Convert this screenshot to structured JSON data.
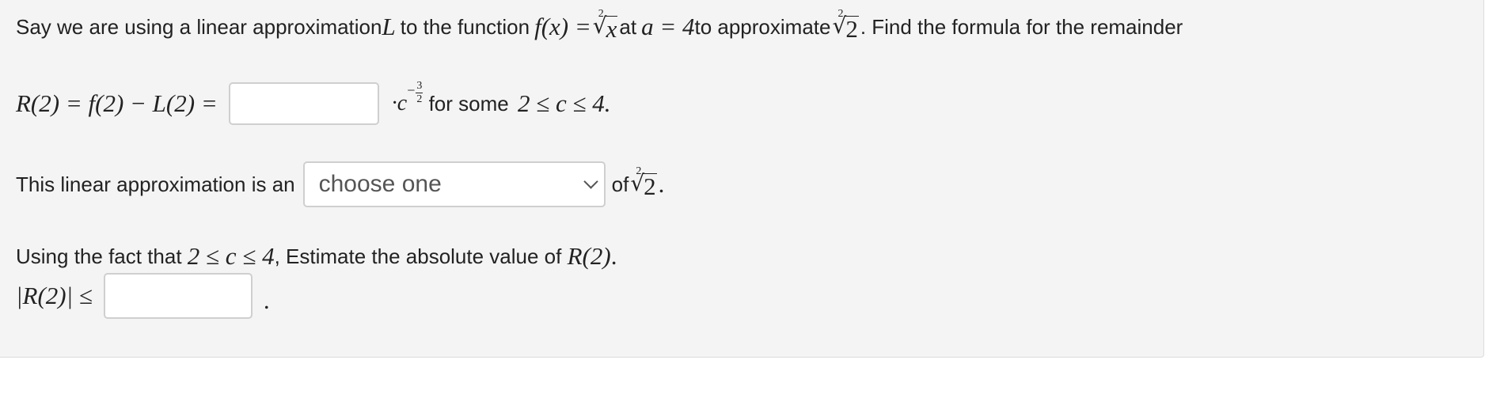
{
  "question": {
    "intro": {
      "t1": "Say we are using a linear approximation ",
      "L": "L",
      "t2": " to the function ",
      "fx": "f(x) = ",
      "rad_index": "2",
      "rad_arg": "x",
      "t3": " at ",
      "a_eq": "a = 4",
      "t4": " to approximate ",
      "rad2_index": "2",
      "rad2_arg": "2",
      "t5": ". Find the formula for the remainder"
    },
    "remainder": {
      "lhs": "R(2) = f(2) − L(2) =",
      "dot_c": "·c",
      "exp_sign": "−",
      "exp_num": "3",
      "exp_den": "2",
      "t1": " for some ",
      "range": "2 ≤ c ≤ 4."
    },
    "approx": {
      "t1": "This linear approximation is an",
      "select_value": "choose one",
      "t2": "of ",
      "rad_index": "2",
      "rad_arg": "2",
      "t3": "."
    },
    "estimate": {
      "t1": "Using the fact that ",
      "range": "2 ≤ c ≤ 4",
      "t2": ", Estimate the absolute value of ",
      "R2": "R(2)",
      "t3": "."
    },
    "bound": {
      "lhs": "|R(2)| ≤",
      "t1": "."
    }
  }
}
